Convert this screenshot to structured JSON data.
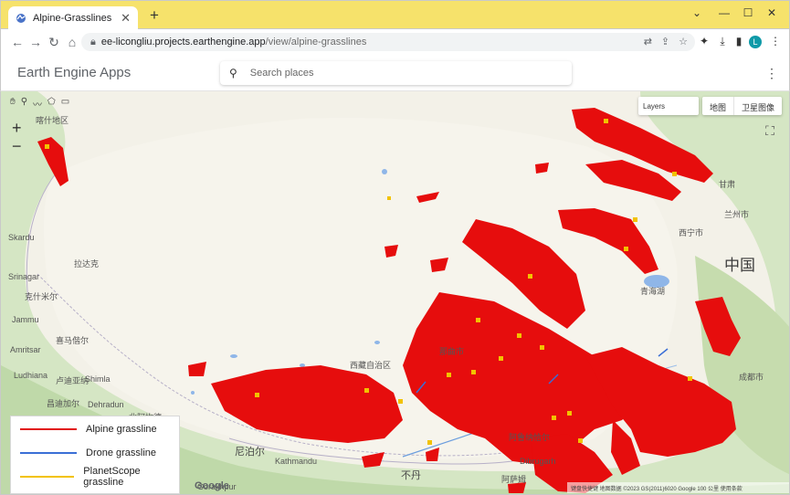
{
  "browser": {
    "tab_title": "Alpine-Grasslines",
    "tab_close": "✕",
    "new_tab": "+",
    "url_host": "ee-licongliu.projects.earthengine.app",
    "url_path": "/view/alpine-grasslines",
    "avatar_letter": "L"
  },
  "app": {
    "brand": "Earth Engine Apps",
    "search_placeholder": "Search places",
    "menu": "⋮"
  },
  "map_controls": {
    "zoom_in": "+",
    "zoom_out": "−",
    "layers_label": "Layers",
    "map_type_map": "地图",
    "map_type_satellite": "卫星图像"
  },
  "places": {
    "kashgar": "喀什地区",
    "skardu": "Skardu",
    "srinagar": "Srinagar",
    "ladakh": "拉达克",
    "kashmir": "克什米尔",
    "jammu": "Jammu",
    "himachal": "喜马偕尔",
    "amritsar": "Amritsar",
    "ludhiana": "Ludhiana",
    "ludhiana_cn": "卢迪亚纳",
    "shimla": "Shimla",
    "chandigarh": "昌迪加尔",
    "dehradun": "Dehradun",
    "uttarakhand": "北阿坎德",
    "nepal": "尼泊尔",
    "kathmandu": "Kathmandu",
    "gorakhpur": "Gorakhpur",
    "bhutan": "不丹",
    "dibrugarh": "Dibrugarh",
    "assam": "阿萨姆",
    "arunachal": "阿鲁纳恰尔",
    "xizang": "西藏自治区",
    "nagqu": "那曲市",
    "china": "中国",
    "gansu": "甘肃",
    "lanzhou": "兰州市",
    "xining": "西宁市",
    "chengdu": "成都市",
    "qinghai_lake": "青海湖"
  },
  "legend": {
    "items": [
      {
        "label": "Alpine grassline",
        "color": "#e11212"
      },
      {
        "label": "Drone grassline",
        "color": "#3b6fd6"
      },
      {
        "label": "PlanetScope grassline",
        "color": "#f2c200"
      }
    ]
  },
  "attribution": "键盘快捷键  地图数据 ©2023 GS(2011)6020 Google  100 公里  使用条款",
  "google_logo": "Google"
}
